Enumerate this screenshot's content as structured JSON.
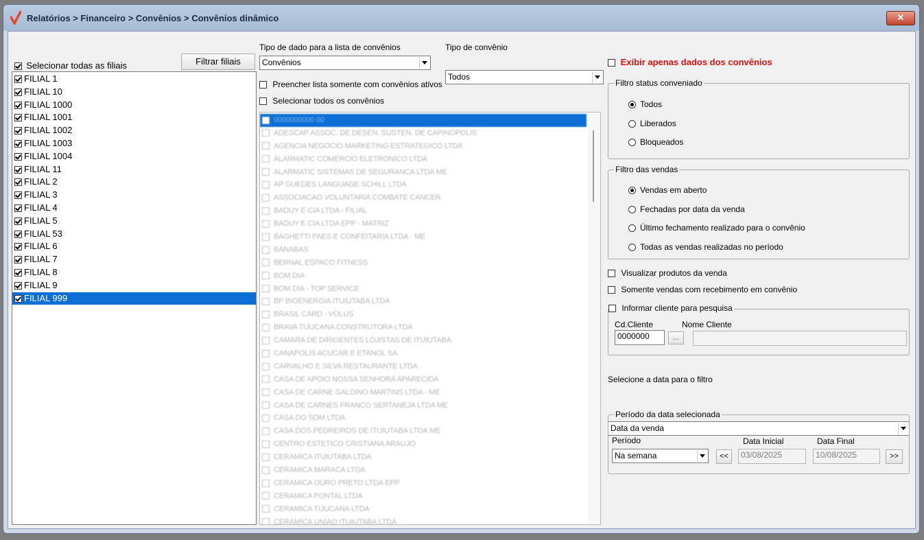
{
  "window": {
    "title": "Relatórios > Financeiro > Convênios > Convênios dinâmico",
    "close_label": "✕"
  },
  "filiais": {
    "select_all_label": "Selecionar todas as filiais",
    "filter_button": "Filtrar filiais",
    "items": [
      "FILIAL 1",
      "FILIAL 10",
      "FILIAL 1000",
      "FILIAL 1001",
      "FILIAL 1002",
      "FILIAL 1003",
      "FILIAL 1004",
      "FILIAL 11",
      "FILIAL 2",
      "FILIAL 3",
      "FILIAL 4",
      "FILIAL 5",
      "FILIAL 53",
      "FILIAL 6",
      "FILIAL 7",
      "FILIAL 8",
      "FILIAL 9",
      "FILIAL 999"
    ],
    "selected": "FILIAL 999"
  },
  "tipo_dado": {
    "label": "Tipo de dado para a lista de convênios",
    "value": "Convênios"
  },
  "tipo_convenio": {
    "label": "Tipo de convênio",
    "value": "Todos"
  },
  "exibir_apenas": {
    "label": "Exibir apenas dados dos convênios",
    "color": "#e01010"
  },
  "preencher_ativos": {
    "label": "Preencher lista somente com convênios ativos"
  },
  "selecionar_todos_conv": {
    "label": "Selecionar todos os convênios"
  },
  "convenios": [
    "0000000000 00",
    "ADESCAP ASSOC. DE DESEN. SUSTEN. DE CAPINOPOLIS",
    "AGENCIA NEGOCIO MARKETING ESTRATEGICO LTDA",
    "ALARMATIC COMERCIO ELETRONICO LTDA",
    "ALARMATIC SISTEMAS DE SEGURANCA LTDA ME",
    "AP GUEDES LANGUAGE SCHILL LTDA",
    "ASSOCIACAO VOLUNTARIA COMBATE CANCER",
    "BADUY E CIA LTDA - FILIAL",
    "BADUY E CIA LTDA EPP - MATRIZ",
    "BAGHETTI PAES E CONFEITARIA LTDA - ME",
    "BANABAS",
    "BERNAL ESPACO FITNESS",
    "BOM DIA",
    "BOM DIA - TOP SERVICE",
    "BP BIOENERGIA ITUIUTABA LTDA",
    "BRASIL CARD - VOLUS",
    "BRAVA TIJUCANA CONSTRUTORA LTDA",
    "CAMARA DE DIRIGENTES LOJISTAS DE ITUIUTABA",
    "CANAPOLIS ACUCAR E ETANOL SA",
    "CARVALHO E SILVA RESTAURANTE LTDA",
    "CASA DE APOIO NOSSA SENHORA APARECIDA",
    "CASA DE CARNE GALDINO MARTINS LTDA - ME",
    "CASA DE CARNES FRANCO SERTANEJA LTDA ME",
    "CASA DO SOM LTDA",
    "CASA DOS PEDREIROS DE ITUIUTABA LTDA ME",
    "CENTRO ESTETICO CRISTIANA ARAUJO",
    "CERAMICA ITUIUTABA LTDA",
    "CERAMICA MARACA LTDA",
    "CERAMICA OURO PRETO LTDA EPP",
    "CERAMICA PONTAL LTDA",
    "CERAMICA TIJUCANA LTDA",
    "CERAMICA UNIAO ITUIUTABA LTDA"
  ],
  "filtro_status": {
    "legend": "Filtro status conveniado",
    "options": [
      "Todos",
      "Liberados",
      "Bloqueados"
    ],
    "selected": "Todos"
  },
  "filtro_vendas": {
    "legend": "Filtro das vendas",
    "options": [
      "Vendas em aberto",
      "Fechadas por data da venda",
      "Último fechamento realizado para o convênio",
      "Todas as vendas realizadas no período"
    ],
    "selected": "Vendas em aberto"
  },
  "visualizar_produtos": {
    "label": "Visualizar produtos da venda"
  },
  "somente_vendas": {
    "label": "Somente vendas com recebimento em convênio"
  },
  "informar_cliente": {
    "label": "Informar cliente para pesquisa",
    "cd_label": "Cd.Cliente",
    "cd_value": "0000000",
    "lookup_label": "...",
    "nome_label": "Nome Cliente",
    "nome_value": ""
  },
  "data_filtro": {
    "label": "Selecione a data para o filtro",
    "value": "Data da venda"
  },
  "periodo_group": {
    "legend": "Período da data selecionada",
    "periodo_label": "Período",
    "periodo_value": "Na semana",
    "prev_label": "<<",
    "next_label": ">>",
    "data_inicial_label": "Data Inicial",
    "data_inicial": "03/08/2025",
    "data_final_label": "Data Final",
    "data_final": "10/08/2025"
  }
}
